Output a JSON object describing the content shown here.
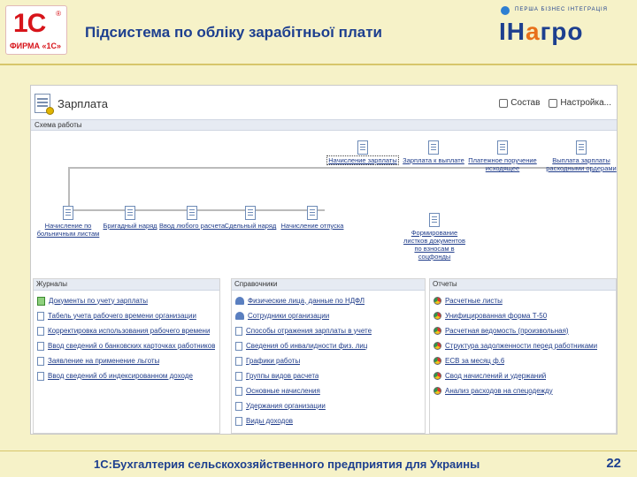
{
  "header": {
    "logo_1c_big": "1С",
    "logo_1c_reg": "®",
    "logo_1c_firm": "ФИРМА «1С»",
    "title": "Підсистема по обліку зарабітньої плати",
    "agro_tagline": "ПЕРША БІЗНЕС ІНТЕГРАЦІЯ",
    "agro_word_start": "ІН",
    "agro_word_accent": "а",
    "agro_word_end": "гро"
  },
  "panel": {
    "title": "Зарплата",
    "subtitle": "Схема работы",
    "actions": [
      {
        "label": "Состав"
      },
      {
        "label": "Настройка..."
      }
    ]
  },
  "diagram": {
    "top_nodes": [
      {
        "label": "Начисление зарплаты"
      },
      {
        "label": "Зарплата к выплате"
      },
      {
        "label": "Платежное поручение исходящее"
      },
      {
        "label": "Выплата зарплаты расходными ордерами"
      }
    ],
    "bottom_nodes": [
      {
        "label": "Начисление по больничным листам"
      },
      {
        "label": "Бригадный наряд"
      },
      {
        "label": "Ввод любого расчета"
      },
      {
        "label": "Сдельный наряд"
      },
      {
        "label": "Начисление отпуска"
      },
      {
        "label": "Формирование листков документов по взносам в соцфонды"
      }
    ]
  },
  "journals": {
    "title": "Журналы",
    "items": [
      {
        "label": "Документы по учету зарплаты",
        "icon": "green-journal-icon"
      },
      {
        "label": "Табель учета рабочего времени организации",
        "icon": "doc-icon"
      },
      {
        "label": "Корректировка использования рабочего времени",
        "icon": "doc-icon"
      },
      {
        "label": "Ввод сведений о банковских карточках работников",
        "icon": "doc-icon"
      },
      {
        "label": "Заявление на применение льготы",
        "icon": "doc-icon"
      },
      {
        "label": "Ввод сведений об индексированном доходе",
        "icon": "doc-icon"
      }
    ]
  },
  "references": {
    "title": "Справочники",
    "items": [
      {
        "label": "Физические лица, данные по НДФЛ",
        "icon": "people-icon"
      },
      {
        "label": "Сотрудники организации",
        "icon": "people-icon"
      },
      {
        "label": "Способы отражения зарплаты в учете",
        "icon": "doc-icon"
      },
      {
        "label": "Сведения об инвалидности физ. лиц",
        "icon": "doc-icon"
      },
      {
        "label": "Графики работы",
        "icon": "doc-icon"
      },
      {
        "label": "Группы видов расчета",
        "icon": "doc-icon"
      },
      {
        "label": "Основные начисления",
        "icon": "doc-icon"
      },
      {
        "label": "Удержания организации",
        "icon": "doc-icon"
      },
      {
        "label": "Виды доходов",
        "icon": "doc-icon"
      }
    ]
  },
  "reports": {
    "title": "Отчеты",
    "items": [
      {
        "label": "Расчетные листы",
        "icon": "report-icon"
      },
      {
        "label": "Унифицированная форма Т-50",
        "icon": "report-icon"
      },
      {
        "label": "Расчетная ведомость (произвольная)",
        "icon": "report-icon"
      },
      {
        "label": "Структура задолженности перед работниками",
        "icon": "report-icon"
      },
      {
        "label": "ЕСВ за месяц ф.6",
        "icon": "report-icon"
      },
      {
        "label": "Свод начислений и удержаний",
        "icon": "report-icon"
      },
      {
        "label": "Анализ расходов на спецодежду",
        "icon": "report-icon"
      }
    ]
  },
  "footer": {
    "text": "1С:Бухгалтерия сельскохозяйственного предприятия для Украины",
    "page_number": "22"
  }
}
